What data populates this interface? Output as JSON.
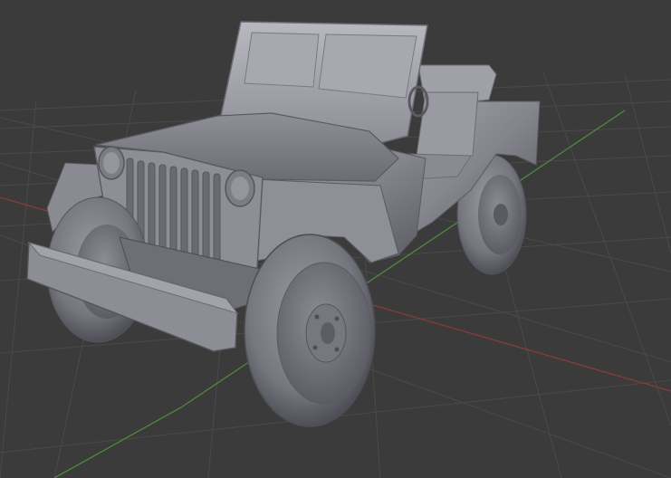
{
  "viewport": {
    "background": "#3b3b3b",
    "grid_color": "#4a4a4a",
    "axis_x_color": "#8a3b3b",
    "axis_y_color": "#4d8a3a",
    "model_body_color": "#8a8a92",
    "model_shadow_color": "#4d4d55",
    "model_highlight_color": "#c0c0c8"
  }
}
